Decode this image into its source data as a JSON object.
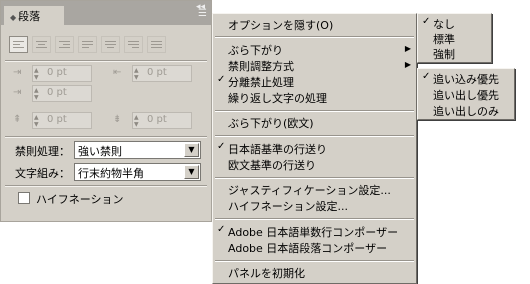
{
  "panel": {
    "tab_title": "段落",
    "composition_label": "禁則処理：",
    "composition_value": "強い禁則",
    "mojikumi_label": "文字組み：",
    "mojikumi_value": "行末約物半角",
    "hyphenation_label": "ハイフネーション",
    "indent_value": "0 pt"
  },
  "main_menu": {
    "items": [
      {
        "label": "オプションを隠す(O)"
      },
      {
        "label": "ぶら下がり"
      },
      {
        "label": "禁則調整方式"
      },
      {
        "label": "分離禁止処理",
        "check": "✓"
      },
      {
        "label": "繰り返し文字の処理"
      },
      {
        "label": "ぶら下がり(欧文)"
      },
      {
        "label": "日本語基準の行送り",
        "check": "✓"
      },
      {
        "label": "欧文基準の行送り"
      },
      {
        "label": "ジャスティフィケーション設定..."
      },
      {
        "label": "ハイフネーション設定..."
      },
      {
        "label": "Adobe 日本語単数行コンポーザー",
        "check": "✓"
      },
      {
        "label": "Adobe 日本語段落コンポーザー"
      },
      {
        "label": "パネルを初期化"
      }
    ]
  },
  "submenu_hanging": {
    "items": [
      {
        "label": "なし",
        "check": "✓"
      },
      {
        "label": "標準"
      },
      {
        "label": "強制"
      }
    ]
  },
  "submenu_kinsoku": {
    "items": [
      {
        "label": "追い込み優先",
        "check": "✓"
      },
      {
        "label": "追い出し優先"
      },
      {
        "label": "追い出しのみ"
      }
    ]
  }
}
